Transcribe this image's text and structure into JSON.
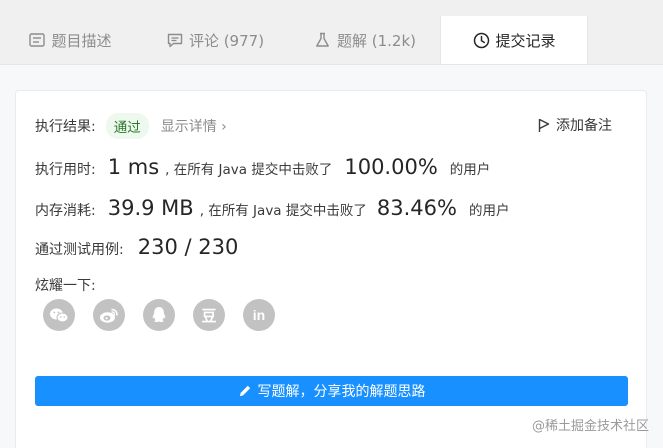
{
  "tabs": {
    "description": "题目描述",
    "comments": "评论 (977)",
    "solutions": "题解 (1.2k)",
    "submissions": "提交记录"
  },
  "result": {
    "label": "执行结果:",
    "status": "通过",
    "details": "显示详情 ›",
    "add_note": "添加备注"
  },
  "runtime": {
    "label": "执行用时:",
    "value": "1 ms",
    "mid": ", 在所有 Java 提交中击败了",
    "percent": "100.00%",
    "suffix": "的用户"
  },
  "memory": {
    "label": "内存消耗:",
    "value": "39.9 MB",
    "mid": ", 在所有 Java 提交中击败了",
    "percent": "83.46%",
    "suffix": "的用户"
  },
  "tests": {
    "label": "通过测试用例:",
    "value": "230 / 230"
  },
  "share": {
    "label": "炫耀一下:",
    "icons": [
      "wechat-icon",
      "weibo-icon",
      "qq-icon",
      "douban-icon",
      "linkedin-icon"
    ],
    "douban_glyph": "豆",
    "linkedin_glyph": "in"
  },
  "write_button": "写题解，分享我的解题思路",
  "watermark": "@稀土掘金技术社区",
  "colors": {
    "primary": "#1890ff",
    "pass_bg": "#eef8ee",
    "pass_text": "#2a7a2a",
    "share_icon": "#c2c2c2"
  }
}
